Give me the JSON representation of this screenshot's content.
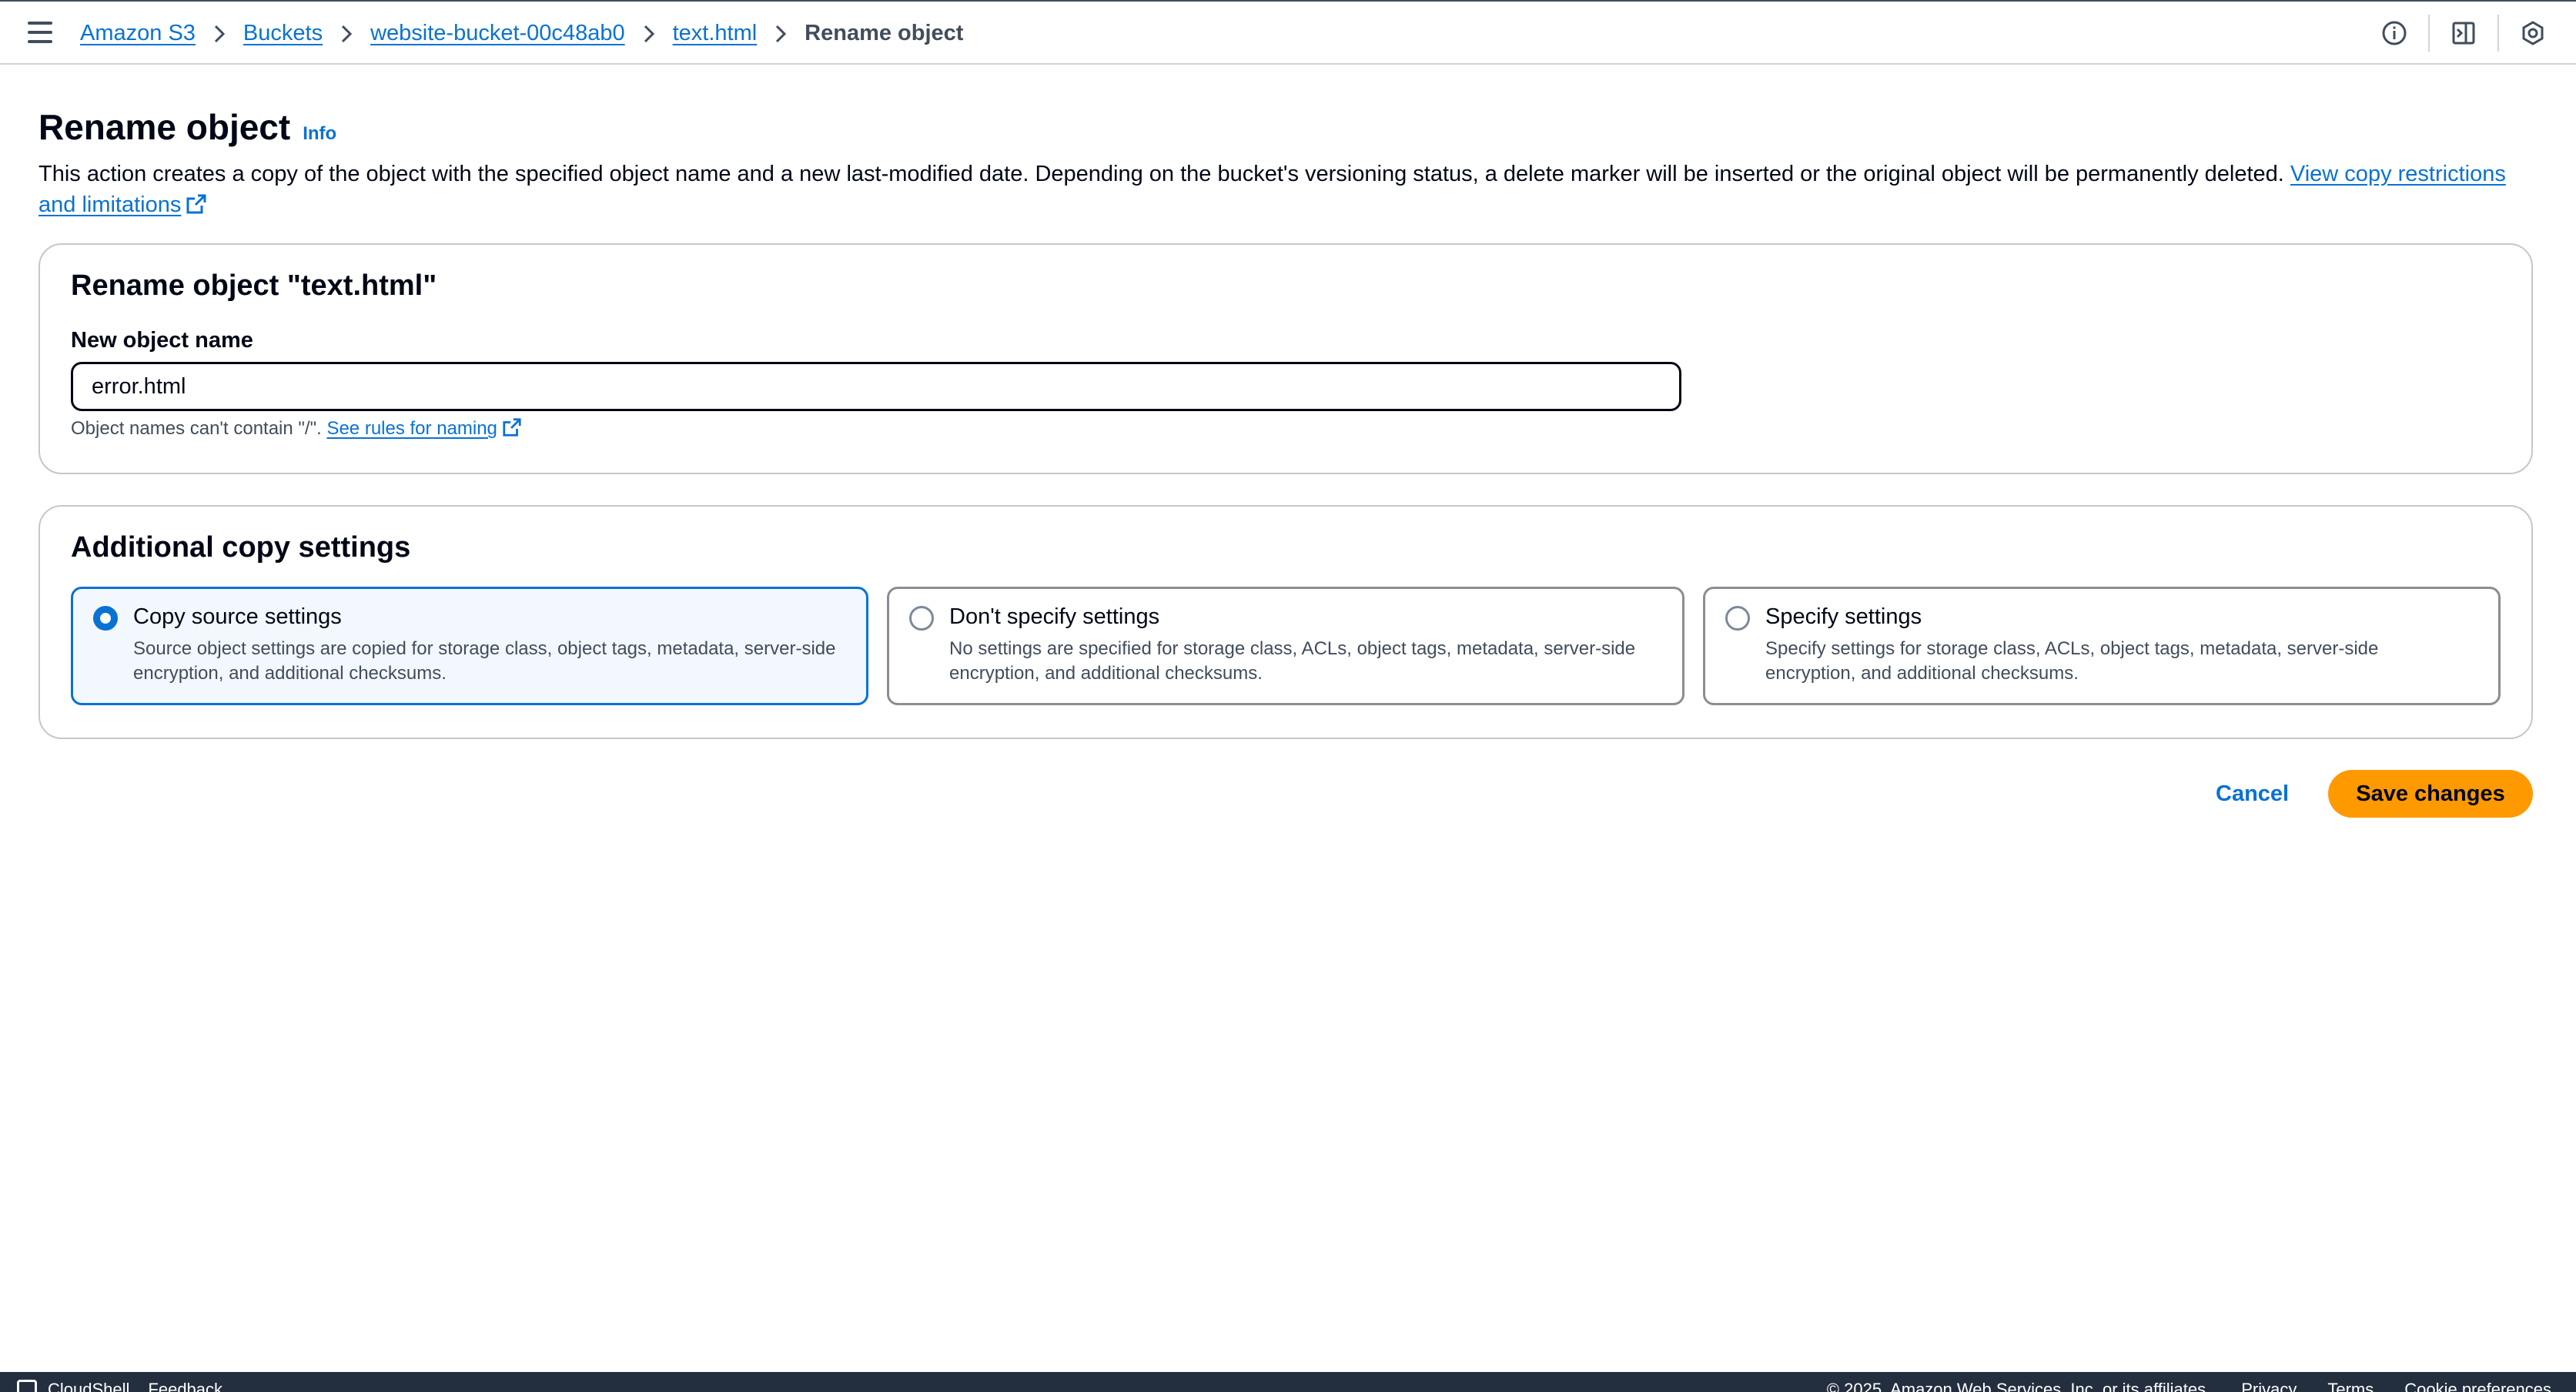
{
  "breadcrumb": {
    "items": [
      {
        "label": "Amazon S3"
      },
      {
        "label": "Buckets"
      },
      {
        "label": "website-bucket-00c48ab0"
      },
      {
        "label": "text.html"
      }
    ],
    "current": "Rename object"
  },
  "header": {
    "title": "Rename object",
    "info_label": "Info",
    "description": "This action creates a copy of the object with the specified object name and a new last-modified date. Depending on the bucket's versioning status, a delete marker will be inserted or the original object will be permanently deleted.",
    "description_link": "View copy restrictions and limitations"
  },
  "rename_panel": {
    "title": "Rename object \"text.html\"",
    "field_label": "New object name",
    "input_value": "error.html",
    "constraint_text": "Object names can't contain \"/\".",
    "constraint_link": "See rules for naming"
  },
  "copy_panel": {
    "title": "Additional copy settings",
    "options": [
      {
        "label": "Copy source settings",
        "description": "Source object settings are copied for storage class, object tags, metadata, server-side encryption, and additional checksums.",
        "selected": true
      },
      {
        "label": "Don't specify settings",
        "description": "No settings are specified for storage class, ACLs, object tags, metadata, server-side encryption, and additional checksums.",
        "selected": false
      },
      {
        "label": "Specify settings",
        "description": "Specify settings for storage class, ACLs, object tags, metadata, server-side encryption, and additional checksums.",
        "selected": false
      }
    ]
  },
  "actions": {
    "cancel_label": "Cancel",
    "save_label": "Save changes"
  },
  "footer": {
    "left": [
      "CloudShell",
      "Feedback"
    ],
    "right": [
      "© 2025, Amazon Web Services, Inc. or its affiliates.",
      "Privacy",
      "Terms",
      "Cookie preferences"
    ]
  },
  "colors": {
    "link": "#0972d3",
    "primary_button": "#ff9900",
    "selected_tile_bg": "#f2f8fd",
    "footer_bg": "#232f3e"
  },
  "icons": {
    "menu": "menu-icon",
    "info": "info-circle-icon",
    "panel": "side-panel-icon",
    "settings": "settings-hexagon-icon",
    "external": "external-link-icon",
    "chevron": "chevron-right-icon"
  }
}
